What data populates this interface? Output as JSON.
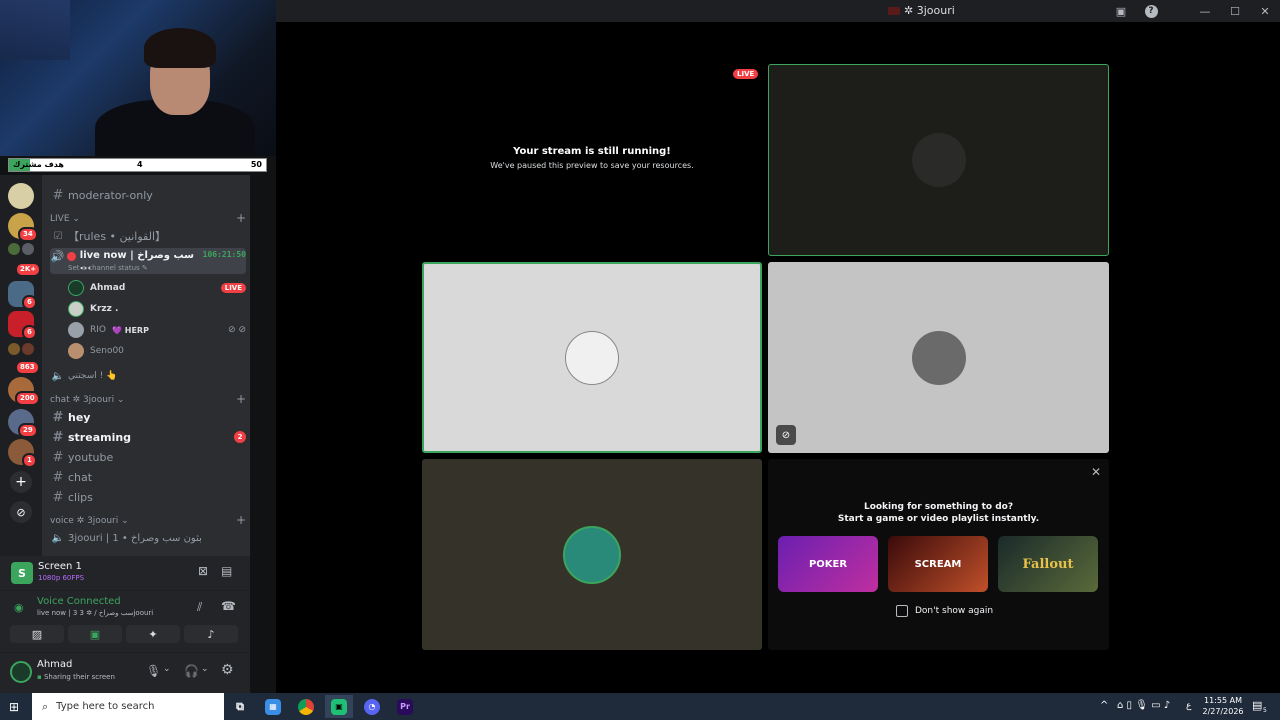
{
  "window": {
    "title": "✲ 3joouri"
  },
  "webcam": {
    "goal_label": "هدف مشترك",
    "goal_current": "4",
    "goal_max": "50",
    "goal_progress": 0.08
  },
  "servers": [
    {
      "badge": ""
    },
    {
      "badge": "34"
    },
    {
      "badge": "2K+"
    },
    {
      "badge": "6"
    },
    {
      "badge": "6"
    },
    {
      "badge": "863"
    },
    {
      "badge": "200"
    },
    {
      "badge": "29"
    },
    {
      "badge": "1"
    }
  ],
  "channels": {
    "moderator_only": "moderator-only",
    "live_category": "LIVE",
    "rules": "【rules • القوانين】",
    "live_voice": "live now | سب وصراخ ...",
    "live_timer": "106:21:50",
    "set_status": "Set a channel status",
    "voice_users": [
      {
        "name": "Ahmad",
        "live": "LIVE"
      },
      {
        "name": "Krzz .",
        "live": ""
      },
      {
        "name": "RIO",
        "tag": "HERP",
        "live": ""
      },
      {
        "name": "Seno00",
        "live": ""
      }
    ],
    "afk_voice": "اسجتني ! 👆",
    "chat_category": "chat ✲ 3joouri",
    "text_channels": [
      {
        "name": "hey",
        "bold": true,
        "unread": ""
      },
      {
        "name": "streaming",
        "bold": true,
        "unread": "2"
      },
      {
        "name": "youtube",
        "bold": false,
        "unread": ""
      },
      {
        "name": "chat",
        "bold": false,
        "unread": ""
      },
      {
        "name": "clips",
        "bold": false,
        "unread": ""
      }
    ],
    "voice_category": "voice ✲ 3joouri",
    "voice_channel": "3joouri | 1 • بثون سب وصراخ"
  },
  "screen_panel": {
    "title": "Screen 1",
    "quality": "1080p 60FPS"
  },
  "voice_panel": {
    "status": "Voice Connected",
    "channel": "live now | 3 سب وصراخ / ✲ 3joouri"
  },
  "user_panel": {
    "name": "Ahmad",
    "status": "Sharing their screen"
  },
  "stage": {
    "live_badge": "LIVE",
    "paused_title": "Your stream is still running!",
    "paused_subtitle": "We've paused this preview to save your resources.",
    "promo_title": "Looking for something to do?",
    "promo_subtitle": "Start a game or video playlist instantly.",
    "promo_cards": [
      {
        "label": "POKER"
      },
      {
        "label": "SCREAM"
      },
      {
        "label": "Fallout"
      }
    ],
    "dont_show": "Don't show again"
  },
  "taskbar": {
    "search_placeholder": "Type here to search",
    "time": "11:55 AM",
    "date": "2/27/2026",
    "lang": "ع",
    "notifications": "5"
  },
  "colors": {
    "accent_green": "#3ba55d",
    "live_red": "#f23f43",
    "blurple": "#5865f2"
  }
}
